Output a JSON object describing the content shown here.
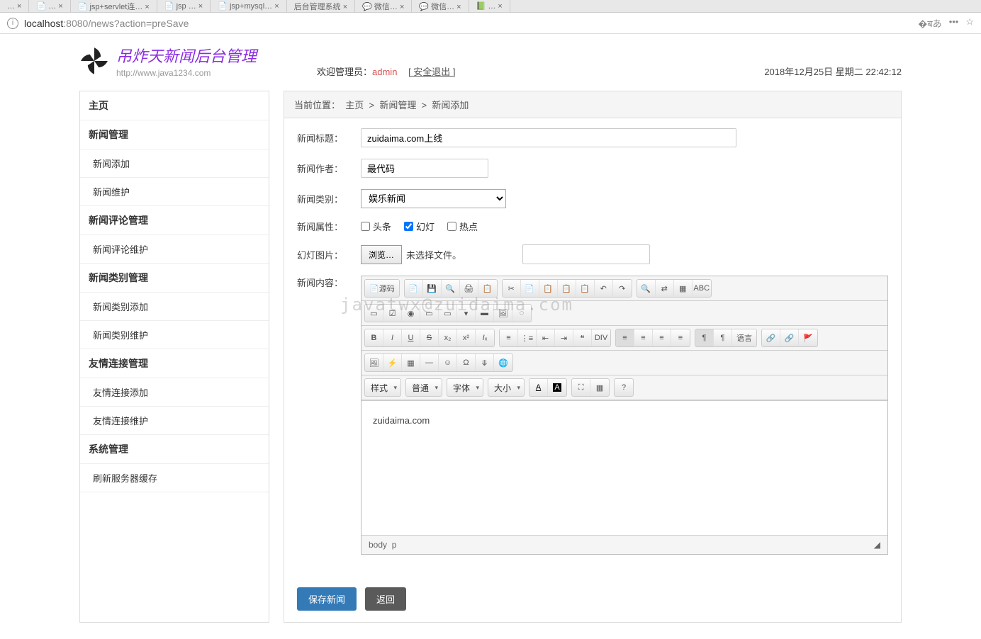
{
  "url": {
    "host": "localhost",
    "port": ":8080",
    "path": "/news?action=preSave"
  },
  "brand": {
    "title": "吊炸天新闻后台管理",
    "sub": "http://www.java1234.com"
  },
  "welcome": {
    "prefix": "欢迎管理员：",
    "admin": "admin",
    "logout": "[ 安全退出 ]"
  },
  "datetime": "2018年12月25日 星期二 22:42:12",
  "sidebar": {
    "home": "主页",
    "g1": "新闻管理",
    "g1a": "新闻添加",
    "g1b": "新闻维护",
    "g2": "新闻评论管理",
    "g2a": "新闻评论维护",
    "g3": "新闻类别管理",
    "g3a": "新闻类别添加",
    "g3b": "新闻类别维护",
    "g4": "友情连接管理",
    "g4a": "友情连接添加",
    "g4b": "友情连接维护",
    "g5": "系统管理",
    "g5a": "刷新服务器缓存"
  },
  "crumb": {
    "loc": "当前位置：",
    "home": "主页",
    "mgmt": "新闻管理",
    "add": "新闻添加"
  },
  "form": {
    "title_label": "新闻标题：",
    "title_value": "zuidaima.com上线",
    "author_label": "新闻作者：",
    "author_value": "最代码",
    "cat_label": "新闻类别：",
    "cat_value": "娱乐新闻",
    "attr_label": "新闻属性：",
    "attr_head": "头条",
    "attr_slide": "幻灯",
    "attr_hot": "热点",
    "slide_label": "幻灯图片：",
    "browse": "浏览…",
    "nofile": "未选择文件。",
    "content_label": "新闻内容：",
    "save": "保存新闻",
    "back": "返回"
  },
  "editor": {
    "source": "源码",
    "styles": "样式",
    "format": "普通",
    "font": "字体",
    "size": "大小",
    "body_text": "zuidaima.com",
    "path_body": "body",
    "path_p": "p"
  },
  "watermark": "javatwx@zuidaima.com"
}
